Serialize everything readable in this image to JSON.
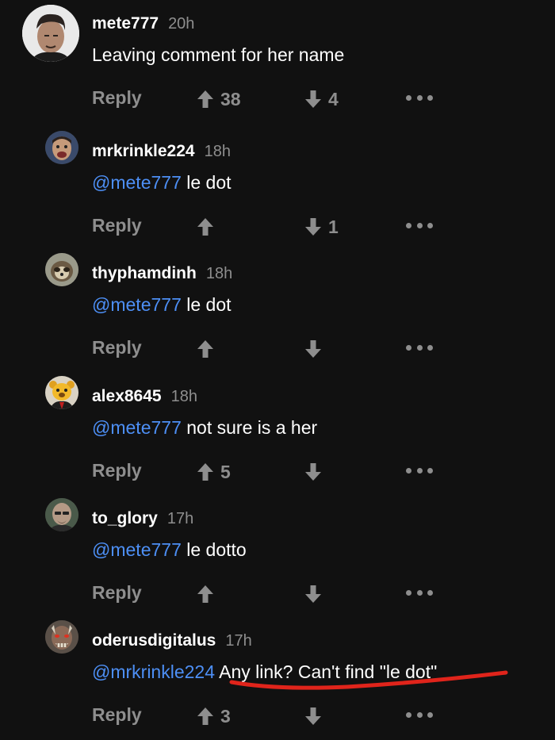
{
  "comments": [
    {
      "username": "mete777",
      "time": "20h",
      "mention": "",
      "text": "Leaving comment for her name",
      "upvotes": "38",
      "downvotes": "4",
      "avatar_icon": "man-portrait-avatar"
    },
    {
      "username": "mrkrinkle224",
      "time": "18h",
      "mention": "@mete777",
      "text": " le dot",
      "upvotes": "",
      "downvotes": "1",
      "avatar_icon": "face-avatar"
    },
    {
      "username": "thyphamdinh",
      "time": "18h",
      "mention": "@mete777",
      "text": " le dot",
      "upvotes": "",
      "downvotes": "",
      "avatar_icon": "sloth-avatar"
    },
    {
      "username": "alex8645",
      "time": "18h",
      "mention": "@mete777",
      "text": " not sure is a her",
      "upvotes": "5",
      "downvotes": "",
      "avatar_icon": "bear-in-suit-avatar"
    },
    {
      "username": "to_glory",
      "time": "17h",
      "mention": "@mete777",
      "text": " le dotto",
      "upvotes": "",
      "downvotes": "",
      "avatar_icon": "bald-man-avatar"
    },
    {
      "username": "oderusdigitalus",
      "time": "17h",
      "mention": "@mrkrinkle224",
      "text": " Any link? Can't find \"le dot\"",
      "upvotes": "3",
      "downvotes": "",
      "avatar_icon": "demon-mask-avatar"
    }
  ],
  "labels": {
    "reply": "Reply"
  },
  "colors": {
    "background": "#111111",
    "mention": "#4d8ff5",
    "muted": "#8e8e8e",
    "annotation": "#e0241b"
  }
}
